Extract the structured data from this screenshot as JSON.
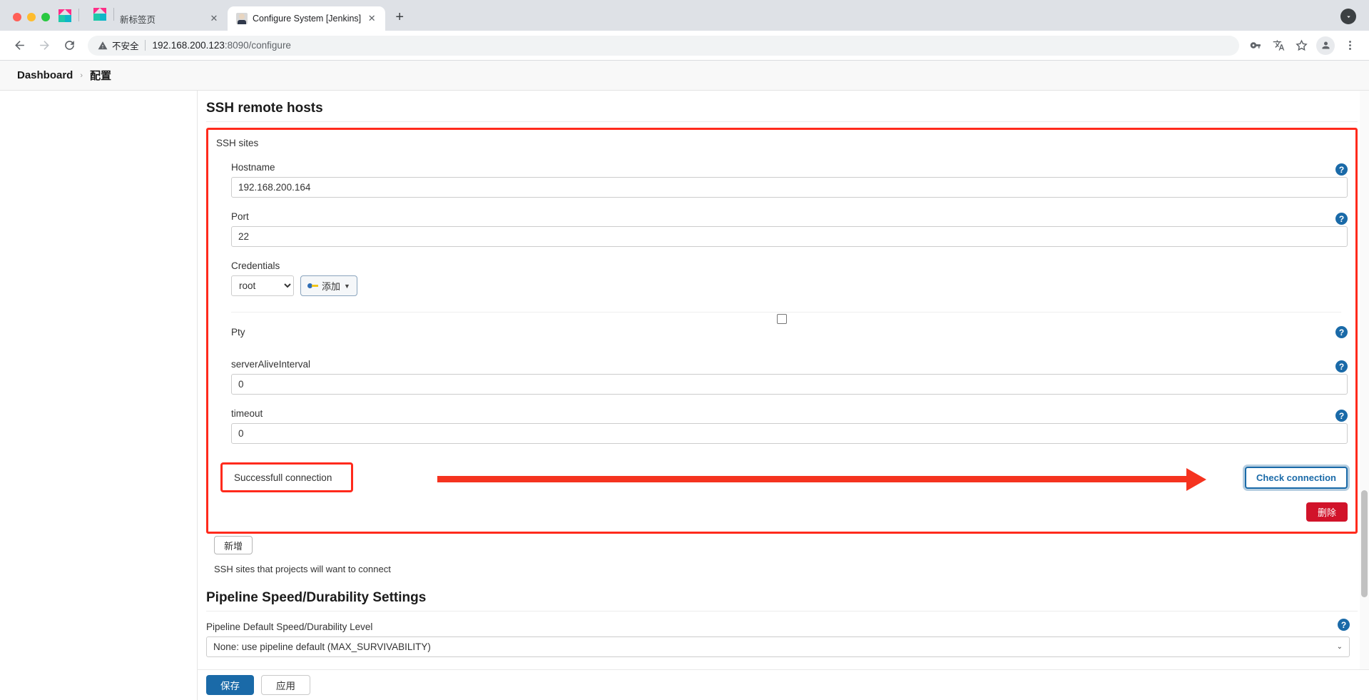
{
  "browser": {
    "tabs": [
      {
        "title": "新标签页",
        "active": false,
        "favicon": "kite-icon"
      },
      {
        "title": "Configure System [Jenkins]",
        "active": true,
        "favicon": "jenkins-icon"
      }
    ],
    "new_tab_label": "+",
    "close_label": "✕",
    "nav": {
      "back": "←",
      "forward": "→",
      "reload": "⟳"
    },
    "omnibox": {
      "security_label": "不安全",
      "url_host": "192.168.200.123",
      "url_path": ":8090/configure"
    },
    "toolbar_icons": [
      "key-icon",
      "translate-icon",
      "bookmark-star-icon",
      "profile-avatar-icon",
      "more-menu-icon"
    ]
  },
  "breadcrumb": {
    "root": "Dashboard",
    "separator": "›",
    "current": "配置"
  },
  "main": {
    "section_title": "SSH remote hosts",
    "ssh_sites_label": "SSH sites",
    "fields": {
      "hostname": {
        "label": "Hostname",
        "value": "192.168.200.164"
      },
      "port": {
        "label": "Port",
        "value": "22"
      },
      "credentials": {
        "label": "Credentials",
        "selected": "root",
        "add_button": "添加"
      },
      "pty": {
        "label": "Pty",
        "checked": false
      },
      "server_alive_interval": {
        "label": "serverAliveInterval",
        "value": "0"
      },
      "timeout": {
        "label": "timeout",
        "value": "0"
      }
    },
    "connection": {
      "result_text": "Successfull connection",
      "check_button": "Check connection"
    },
    "delete_button": "删除",
    "add_site_button": "新增",
    "help_text": "SSH sites that projects will want to connect",
    "help_icon_glyph": "?"
  },
  "pipeline": {
    "section_title": "Pipeline Speed/Durability Settings",
    "level_label": "Pipeline Default Speed/Durability Level",
    "level_value": "None: use pipeline default (MAX_SURVIVABILITY)"
  },
  "footer": {
    "save": "保存",
    "apply": "应用"
  },
  "colors": {
    "annotation_red": "#ff2a1c",
    "arrow_red": "#f5331f",
    "jenkins_blue": "#1a6aa8",
    "delete_red": "#d1132a"
  }
}
